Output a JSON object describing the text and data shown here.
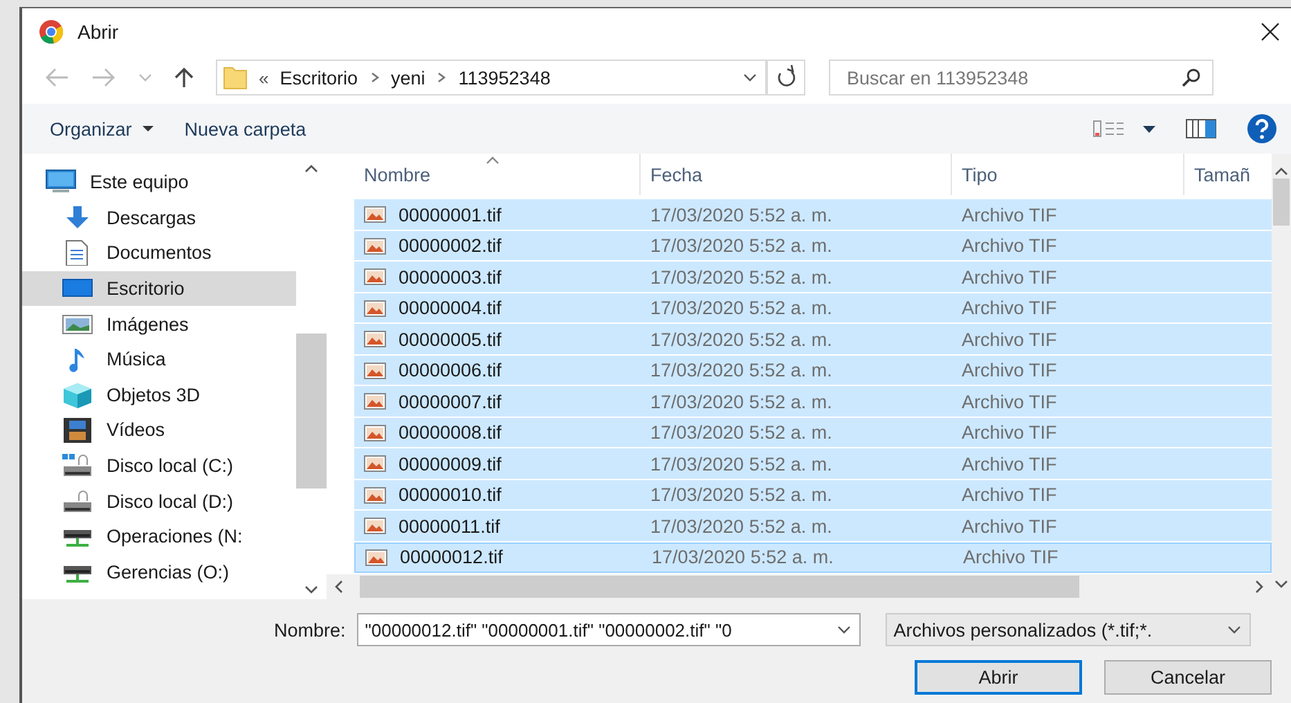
{
  "window": {
    "title": "Abrir"
  },
  "address": {
    "overflow": "«",
    "path": [
      "Escritorio",
      "yeni",
      "113952348"
    ]
  },
  "search": {
    "placeholder": "Buscar en 113952348"
  },
  "toolbar": {
    "organize": "Organizar",
    "new_folder": "Nueva carpeta"
  },
  "sidebar": {
    "items": [
      {
        "label": "Este equipo",
        "kind": "pc",
        "selected": false,
        "children": [
          {
            "label": "Descargas",
            "kind": "downloads",
            "selected": false
          },
          {
            "label": "Documentos",
            "kind": "documents",
            "selected": false
          },
          {
            "label": "Escritorio",
            "kind": "desktop",
            "selected": true
          },
          {
            "label": "Imágenes",
            "kind": "pictures",
            "selected": false
          },
          {
            "label": "Música",
            "kind": "music",
            "selected": false
          },
          {
            "label": "Objetos 3D",
            "kind": "objects",
            "selected": false
          },
          {
            "label": "Vídeos",
            "kind": "videos",
            "selected": false
          },
          {
            "label": "Disco local (C:)",
            "kind": "system-drive",
            "selected": false
          },
          {
            "label": "Disco local (D:)",
            "kind": "drive",
            "selected": false
          },
          {
            "label": "Operaciones (N:",
            "kind": "network",
            "selected": false
          },
          {
            "label": "Gerencias (O:)",
            "kind": "network",
            "selected": false
          }
        ]
      }
    ]
  },
  "table": {
    "columns": [
      {
        "label": "Nombre",
        "sorted": true
      },
      {
        "label": "Fecha",
        "sorted": false
      },
      {
        "label": "Tipo",
        "sorted": false
      },
      {
        "label": "Tamañ",
        "sorted": false
      }
    ],
    "rows": [
      {
        "name": "00000001.tif",
        "date": "17/03/2020 5:52 a. m.",
        "type": "Archivo TIF",
        "selected": true,
        "focused": false
      },
      {
        "name": "00000002.tif",
        "date": "17/03/2020 5:52 a. m.",
        "type": "Archivo TIF",
        "selected": true,
        "focused": false
      },
      {
        "name": "00000003.tif",
        "date": "17/03/2020 5:52 a. m.",
        "type": "Archivo TIF",
        "selected": true,
        "focused": false
      },
      {
        "name": "00000004.tif",
        "date": "17/03/2020 5:52 a. m.",
        "type": "Archivo TIF",
        "selected": true,
        "focused": false
      },
      {
        "name": "00000005.tif",
        "date": "17/03/2020 5:52 a. m.",
        "type": "Archivo TIF",
        "selected": true,
        "focused": false
      },
      {
        "name": "00000006.tif",
        "date": "17/03/2020 5:52 a. m.",
        "type": "Archivo TIF",
        "selected": true,
        "focused": false
      },
      {
        "name": "00000007.tif",
        "date": "17/03/2020 5:52 a. m.",
        "type": "Archivo TIF",
        "selected": true,
        "focused": false
      },
      {
        "name": "00000008.tif",
        "date": "17/03/2020 5:52 a. m.",
        "type": "Archivo TIF",
        "selected": true,
        "focused": false
      },
      {
        "name": "00000009.tif",
        "date": "17/03/2020 5:52 a. m.",
        "type": "Archivo TIF",
        "selected": true,
        "focused": false
      },
      {
        "name": "00000010.tif",
        "date": "17/03/2020 5:52 a. m.",
        "type": "Archivo TIF",
        "selected": true,
        "focused": false
      },
      {
        "name": "00000011.tif",
        "date": "17/03/2020 5:52 a. m.",
        "type": "Archivo TIF",
        "selected": true,
        "focused": false
      },
      {
        "name": "00000012.tif",
        "date": "17/03/2020 5:52 a. m.",
        "type": "Archivo TIF",
        "selected": true,
        "focused": true
      }
    ]
  },
  "footer": {
    "filename_label": "Nombre:",
    "filename_value": "\"00000012.tif\" \"00000001.tif\" \"00000002.tif\" \"0",
    "filter": "Archivos personalizados (*.tif;*.",
    "open": "Abrir",
    "cancel": "Cancelar"
  }
}
